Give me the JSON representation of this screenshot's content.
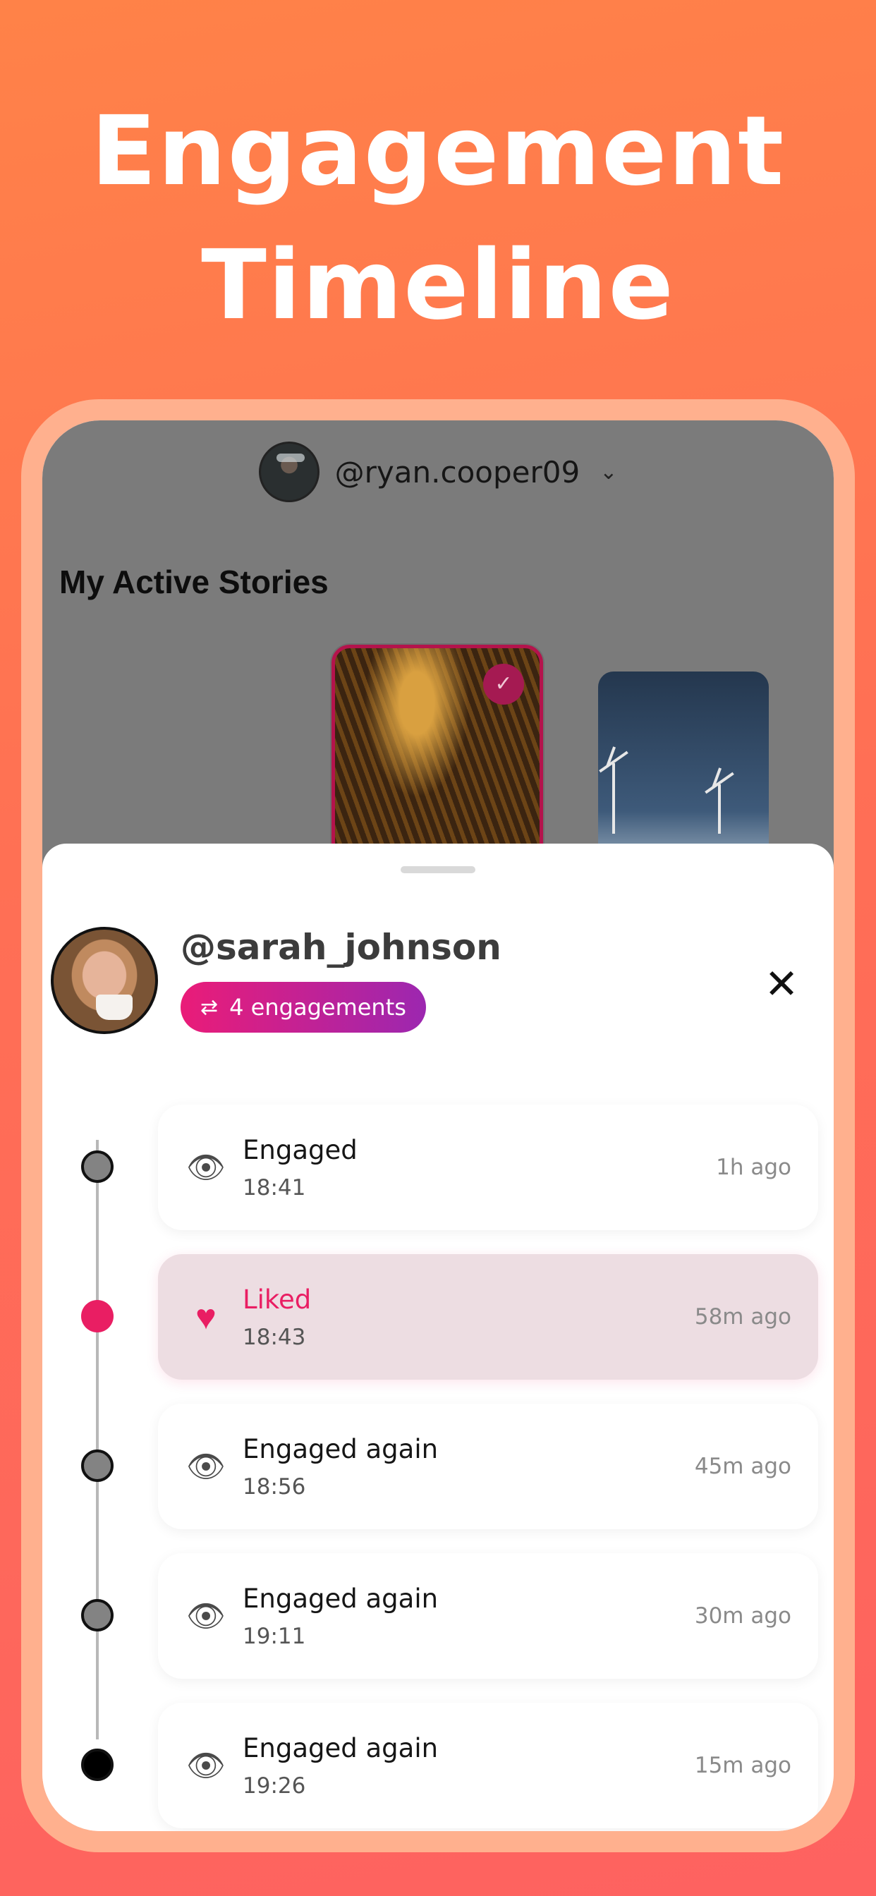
{
  "headline": {
    "line1": "Engagement",
    "line2": "Timeline"
  },
  "background_app": {
    "account_name": "@ryan.cooper09",
    "section_title": "My Active Stories"
  },
  "sheet": {
    "username": "@sarah_johnson",
    "engagements_badge": "4 engagements",
    "close_icon": "✕",
    "events": [
      {
        "icon": "eye-icon",
        "title": "Engaged",
        "time": "18:41",
        "ago": "1h ago"
      },
      {
        "icon": "heart-icon",
        "title": "Liked",
        "time": "18:43",
        "ago": "58m ago"
      },
      {
        "icon": "eye-icon",
        "title": "Engaged again",
        "time": "18:56",
        "ago": "45m ago"
      },
      {
        "icon": "eye-icon",
        "title": "Engaged again",
        "time": "19:11",
        "ago": "30m ago"
      },
      {
        "icon": "eye-icon",
        "title": "Engaged again",
        "time": "19:26",
        "ago": "15m ago"
      }
    ]
  },
  "colors": {
    "accent_pink": "#e91e63",
    "badge_gradient_end": "#9c27b0",
    "background_orange": "#ff7650"
  }
}
